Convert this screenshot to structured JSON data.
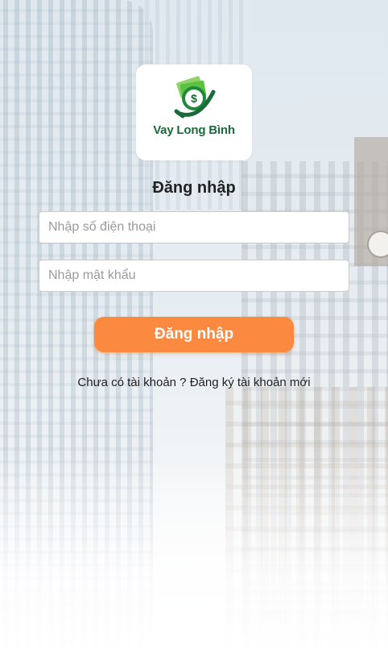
{
  "logo": {
    "name": "Vay Long Bình",
    "colors": {
      "green_dark": "#1a6a3a",
      "green_light": "#5cc043"
    }
  },
  "login": {
    "title": "Đăng nhập",
    "phone_placeholder": "Nhập số điện thoại",
    "password_placeholder": "Nhập mật khẩu",
    "submit_label": "Đăng nhập",
    "submit_color": "#fb8a40"
  },
  "signup": {
    "prompt": "Chưa có tài khoản ? ",
    "link_label": "Đăng ký tài khoản mới"
  }
}
